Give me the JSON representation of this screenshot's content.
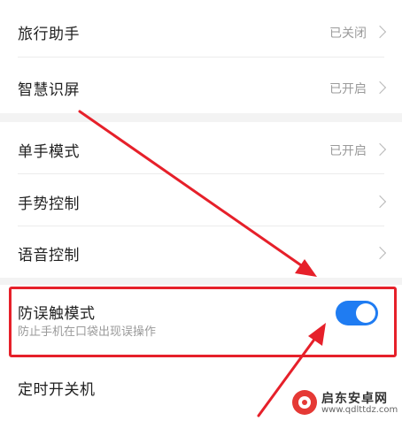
{
  "settings": {
    "group1": [
      {
        "title": "旅行助手",
        "value": "已关闭",
        "icon": "chevron-right-icon"
      },
      {
        "title": "智慧识屏",
        "value": "已开启",
        "icon": "chevron-right-icon"
      }
    ],
    "group2": [
      {
        "title": "单手模式",
        "value": "已开启",
        "icon": "chevron-right-icon"
      },
      {
        "title": "手势控制",
        "value": "",
        "icon": "chevron-right-icon"
      },
      {
        "title": "语音控制",
        "value": "",
        "icon": "chevron-right-icon"
      }
    ],
    "mistouch": {
      "title": "防误触模式",
      "subtitle": "防止手机在口袋出现误操作",
      "toggle_on": true,
      "toggle_color": "#1f7cf2"
    },
    "timer": {
      "title": "定时开关机"
    }
  },
  "annotations": {
    "highlight_color": "#e6202a"
  },
  "watermark": {
    "brand": "启东安卓网",
    "url": "www.qdlttdz.com"
  }
}
